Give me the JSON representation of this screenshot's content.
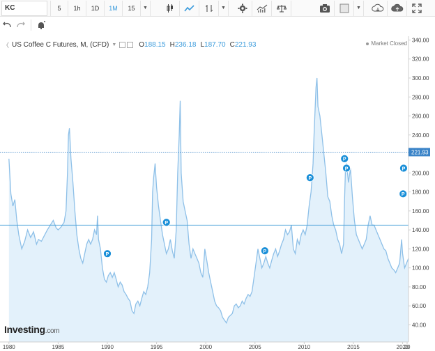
{
  "toolbar": {
    "symbol": "KC",
    "timeframes": [
      "5",
      "1h",
      "1D",
      "1M",
      "15"
    ],
    "active_timeframe": "1M",
    "icons": [
      "candles-icon",
      "area-chart-icon",
      "indicator-icon",
      "settings-icon",
      "volume-icon",
      "balance-icon",
      "camera-icon",
      "color-square-icon",
      "cloud-download-icon",
      "cloud-upload-icon",
      "fullscreen-icon"
    ]
  },
  "toolbar2": {
    "icons": [
      "undo-icon",
      "redo-icon",
      "alert-icon"
    ]
  },
  "legend": {
    "title": "US Coffee C Futures, M, (CFD)",
    "open_label": "O",
    "open": "188.15",
    "high_label": "H",
    "high": "236.18",
    "low_label": "L",
    "low": "187.70",
    "close_label": "C",
    "close": "221.93"
  },
  "market_status": "Market Closed",
  "watermark": {
    "brand": "Investing",
    "suffix": ".com"
  },
  "colors": {
    "line": "#8ec0e8",
    "fill": "#e3f1fb",
    "accent": "#1a8fd8",
    "label_bg": "#3b84c8"
  },
  "chart_data": {
    "type": "area",
    "title": "US Coffee C Futures, M, (CFD)",
    "x_ticks": [
      "1980",
      "1985",
      "1990",
      "1995",
      "2000",
      "2005",
      "2010",
      "2015",
      "2020",
      "20"
    ],
    "y_ticks": [
      "340.00",
      "320.00",
      "300.00",
      "280.00",
      "260.00",
      "240.00",
      "220.00",
      "200.00",
      "180.00",
      "160.00",
      "140.00",
      "120.00",
      "100.00",
      "80.00",
      "60.00",
      "40.00"
    ],
    "ylim": [
      22,
      344
    ],
    "xlim": [
      1979.8,
      2020.6
    ],
    "last_value": 221.93,
    "last_value_label": "221.93",
    "horizontal_line": 145,
    "series": [
      {
        "values": [
          [
            1980.0,
            215
          ],
          [
            1980.2,
            178
          ],
          [
            1980.4,
            165
          ],
          [
            1980.6,
            172
          ],
          [
            1980.8,
            150
          ],
          [
            1981.0,
            135
          ],
          [
            1981.3,
            120
          ],
          [
            1981.6,
            128
          ],
          [
            1981.9,
            140
          ],
          [
            1982.2,
            132
          ],
          [
            1982.5,
            138
          ],
          [
            1982.8,
            125
          ],
          [
            1983.0,
            130
          ],
          [
            1983.3,
            128
          ],
          [
            1983.6,
            134
          ],
          [
            1983.9,
            140
          ],
          [
            1984.2,
            145
          ],
          [
            1984.5,
            150
          ],
          [
            1984.8,
            142
          ],
          [
            1985.0,
            140
          ],
          [
            1985.3,
            143
          ],
          [
            1985.6,
            148
          ],
          [
            1985.8,
            160
          ],
          [
            1985.95,
            200
          ],
          [
            1986.05,
            240
          ],
          [
            1986.15,
            247
          ],
          [
            1986.3,
            215
          ],
          [
            1986.5,
            190
          ],
          [
            1986.7,
            160
          ],
          [
            1986.9,
            135
          ],
          [
            1987.1,
            120
          ],
          [
            1987.3,
            110
          ],
          [
            1987.5,
            105
          ],
          [
            1987.7,
            115
          ],
          [
            1987.9,
            125
          ],
          [
            1988.1,
            130
          ],
          [
            1988.3,
            125
          ],
          [
            1988.5,
            130
          ],
          [
            1988.7,
            140
          ],
          [
            1988.9,
            135
          ],
          [
            1989.0,
            155
          ],
          [
            1989.1,
            130
          ],
          [
            1989.3,
            120
          ],
          [
            1989.5,
            100
          ],
          [
            1989.7,
            88
          ],
          [
            1989.9,
            85
          ],
          [
            1990.1,
            92
          ],
          [
            1990.3,
            95
          ],
          [
            1990.5,
            90
          ],
          [
            1990.7,
            95
          ],
          [
            1990.9,
            88
          ],
          [
            1991.1,
            80
          ],
          [
            1991.3,
            85
          ],
          [
            1991.5,
            82
          ],
          [
            1991.7,
            75
          ],
          [
            1991.9,
            72
          ],
          [
            1992.1,
            68
          ],
          [
            1992.3,
            65
          ],
          [
            1992.5,
            55
          ],
          [
            1992.7,
            52
          ],
          [
            1992.9,
            62
          ],
          [
            1993.1,
            65
          ],
          [
            1993.3,
            60
          ],
          [
            1993.5,
            68
          ],
          [
            1993.7,
            75
          ],
          [
            1993.9,
            72
          ],
          [
            1994.1,
            80
          ],
          [
            1994.3,
            95
          ],
          [
            1994.5,
            130
          ],
          [
            1994.6,
            180
          ],
          [
            1994.7,
            195
          ],
          [
            1994.85,
            210
          ],
          [
            1995.0,
            185
          ],
          [
            1995.2,
            165
          ],
          [
            1995.4,
            150
          ],
          [
            1995.6,
            135
          ],
          [
            1995.8,
            125
          ],
          [
            1996.0,
            115
          ],
          [
            1996.2,
            120
          ],
          [
            1996.4,
            130
          ],
          [
            1996.6,
            118
          ],
          [
            1996.8,
            110
          ],
          [
            1997.0,
            140
          ],
          [
            1997.15,
            200
          ],
          [
            1997.3,
            240
          ],
          [
            1997.4,
            276
          ],
          [
            1997.5,
            200
          ],
          [
            1997.7,
            170
          ],
          [
            1997.9,
            160
          ],
          [
            1998.1,
            150
          ],
          [
            1998.3,
            125
          ],
          [
            1998.5,
            110
          ],
          [
            1998.7,
            120
          ],
          [
            1998.9,
            115
          ],
          [
            1999.1,
            110
          ],
          [
            1999.3,
            105
          ],
          [
            1999.5,
            95
          ],
          [
            1999.7,
            90
          ],
          [
            1999.9,
            120
          ],
          [
            2000.1,
            108
          ],
          [
            2000.3,
            95
          ],
          [
            2000.5,
            85
          ],
          [
            2000.7,
            75
          ],
          [
            2000.9,
            65
          ],
          [
            2001.1,
            60
          ],
          [
            2001.3,
            58
          ],
          [
            2001.5,
            55
          ],
          [
            2001.7,
            48
          ],
          [
            2001.9,
            45
          ],
          [
            2002.1,
            42
          ],
          [
            2002.3,
            48
          ],
          [
            2002.5,
            50
          ],
          [
            2002.7,
            52
          ],
          [
            2002.9,
            60
          ],
          [
            2003.1,
            62
          ],
          [
            2003.3,
            58
          ],
          [
            2003.5,
            60
          ],
          [
            2003.7,
            65
          ],
          [
            2003.9,
            62
          ],
          [
            2004.1,
            68
          ],
          [
            2004.3,
            72
          ],
          [
            2004.5,
            70
          ],
          [
            2004.7,
            75
          ],
          [
            2004.9,
            90
          ],
          [
            2005.1,
            105
          ],
          [
            2005.3,
            120
          ],
          [
            2005.5,
            110
          ],
          [
            2005.7,
            100
          ],
          [
            2005.9,
            105
          ],
          [
            2006.1,
            112
          ],
          [
            2006.3,
            105
          ],
          [
            2006.5,
            100
          ],
          [
            2006.7,
            108
          ],
          [
            2006.9,
            115
          ],
          [
            2007.1,
            120
          ],
          [
            2007.3,
            112
          ],
          [
            2007.5,
            118
          ],
          [
            2007.7,
            125
          ],
          [
            2007.9,
            130
          ],
          [
            2008.1,
            140
          ],
          [
            2008.3,
            135
          ],
          [
            2008.5,
            138
          ],
          [
            2008.7,
            145
          ],
          [
            2008.9,
            120
          ],
          [
            2009.1,
            115
          ],
          [
            2009.3,
            130
          ],
          [
            2009.5,
            125
          ],
          [
            2009.7,
            135
          ],
          [
            2009.9,
            140
          ],
          [
            2010.1,
            135
          ],
          [
            2010.3,
            145
          ],
          [
            2010.5,
            165
          ],
          [
            2010.7,
            180
          ],
          [
            2010.9,
            210
          ],
          [
            2011.0,
            240
          ],
          [
            2011.1,
            265
          ],
          [
            2011.2,
            290
          ],
          [
            2011.3,
            300
          ],
          [
            2011.4,
            270
          ],
          [
            2011.6,
            260
          ],
          [
            2011.8,
            240
          ],
          [
            2012.0,
            220
          ],
          [
            2012.2,
            200
          ],
          [
            2012.4,
            175
          ],
          [
            2012.6,
            170
          ],
          [
            2012.8,
            155
          ],
          [
            2013.0,
            145
          ],
          [
            2013.2,
            140
          ],
          [
            2013.4,
            130
          ],
          [
            2013.6,
            125
          ],
          [
            2013.8,
            115
          ],
          [
            2014.0,
            125
          ],
          [
            2014.1,
            170
          ],
          [
            2014.2,
            205
          ],
          [
            2014.3,
            210
          ],
          [
            2014.5,
            190
          ],
          [
            2014.7,
            205
          ],
          [
            2014.9,
            175
          ],
          [
            2015.1,
            150
          ],
          [
            2015.3,
            135
          ],
          [
            2015.5,
            130
          ],
          [
            2015.7,
            125
          ],
          [
            2015.9,
            120
          ],
          [
            2016.1,
            125
          ],
          [
            2016.3,
            130
          ],
          [
            2016.5,
            145
          ],
          [
            2016.7,
            155
          ],
          [
            2016.9,
            145
          ],
          [
            2017.1,
            145
          ],
          [
            2017.3,
            140
          ],
          [
            2017.5,
            135
          ],
          [
            2017.7,
            130
          ],
          [
            2017.9,
            125
          ],
          [
            2018.1,
            120
          ],
          [
            2018.3,
            118
          ],
          [
            2018.5,
            110
          ],
          [
            2018.7,
            105
          ],
          [
            2018.9,
            100
          ],
          [
            2019.1,
            98
          ],
          [
            2019.3,
            95
          ],
          [
            2019.5,
            100
          ],
          [
            2019.7,
            105
          ],
          [
            2019.9,
            130
          ],
          [
            2020.0,
            115
          ],
          [
            2020.2,
            100
          ],
          [
            2020.4,
            105
          ],
          [
            2020.6,
            110
          ]
        ]
      }
    ]
  }
}
